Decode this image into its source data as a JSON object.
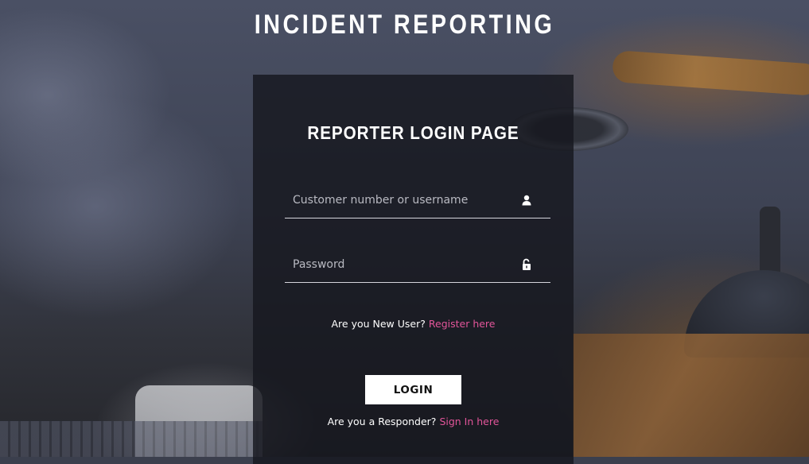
{
  "site": {
    "title": "INCIDENT REPORTING"
  },
  "login": {
    "heading": "REPORTER LOGIN PAGE",
    "username": {
      "placeholder": "Customer number or username",
      "value": "",
      "icon": "user-icon"
    },
    "password": {
      "placeholder": "Password",
      "value": "",
      "icon": "unlock-icon"
    },
    "register_prompt": "Are you New User?",
    "register_link": "Register here",
    "submit_label": "LOGIN",
    "responder_prompt": "Are you a Responder?",
    "responder_link": "Sign In here"
  },
  "colors": {
    "accent_link": "#e2559a",
    "panel": "#16171e",
    "button": "#ffffff"
  }
}
